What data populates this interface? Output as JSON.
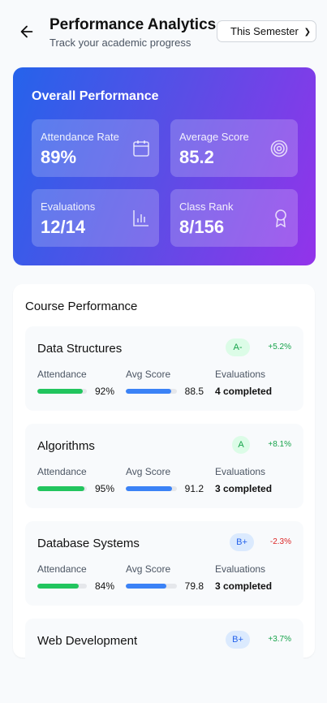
{
  "header": {
    "title": "Performance Analytics",
    "subtitle": "Track your academic progress",
    "period": "This Semester"
  },
  "overall": {
    "title": "Overall Performance",
    "stats": [
      {
        "label": "Attendance Rate",
        "value": "89%",
        "icon": "calendar-icon"
      },
      {
        "label": "Average Score",
        "value": "85.2",
        "icon": "target-icon"
      },
      {
        "label": "Evaluations",
        "value": "12/14",
        "icon": "bar-chart-icon"
      },
      {
        "label": "Class Rank",
        "value": "8/156",
        "icon": "award-icon"
      }
    ]
  },
  "courses": {
    "title": "Course Performance",
    "labels": {
      "attendance": "Attendance",
      "score": "Avg Score",
      "evaluations": "Evaluations"
    },
    "items": [
      {
        "name": "Data Structures",
        "grade": "A-",
        "trend": "+5.2%",
        "attendance": "92%",
        "attendance_pct": 92,
        "score": "88.5",
        "score_pct": 88.5,
        "evaluations": "4 completed"
      },
      {
        "name": "Algorithms",
        "grade": "A",
        "trend": "+8.1%",
        "attendance": "95%",
        "attendance_pct": 95,
        "score": "91.2",
        "score_pct": 91.2,
        "evaluations": "3 completed"
      },
      {
        "name": "Database Systems",
        "grade": "B+",
        "trend": "-2.3%",
        "attendance": "84%",
        "attendance_pct": 84,
        "score": "79.8",
        "score_pct": 79.8,
        "evaluations": "3 completed"
      },
      {
        "name": "Web Development",
        "grade": "B+",
        "trend": "+3.7%"
      }
    ]
  },
  "colors": {
    "green": "#22c55e",
    "blue": "#3b82f6",
    "up": "#16a34a",
    "down": "#dc2626"
  }
}
